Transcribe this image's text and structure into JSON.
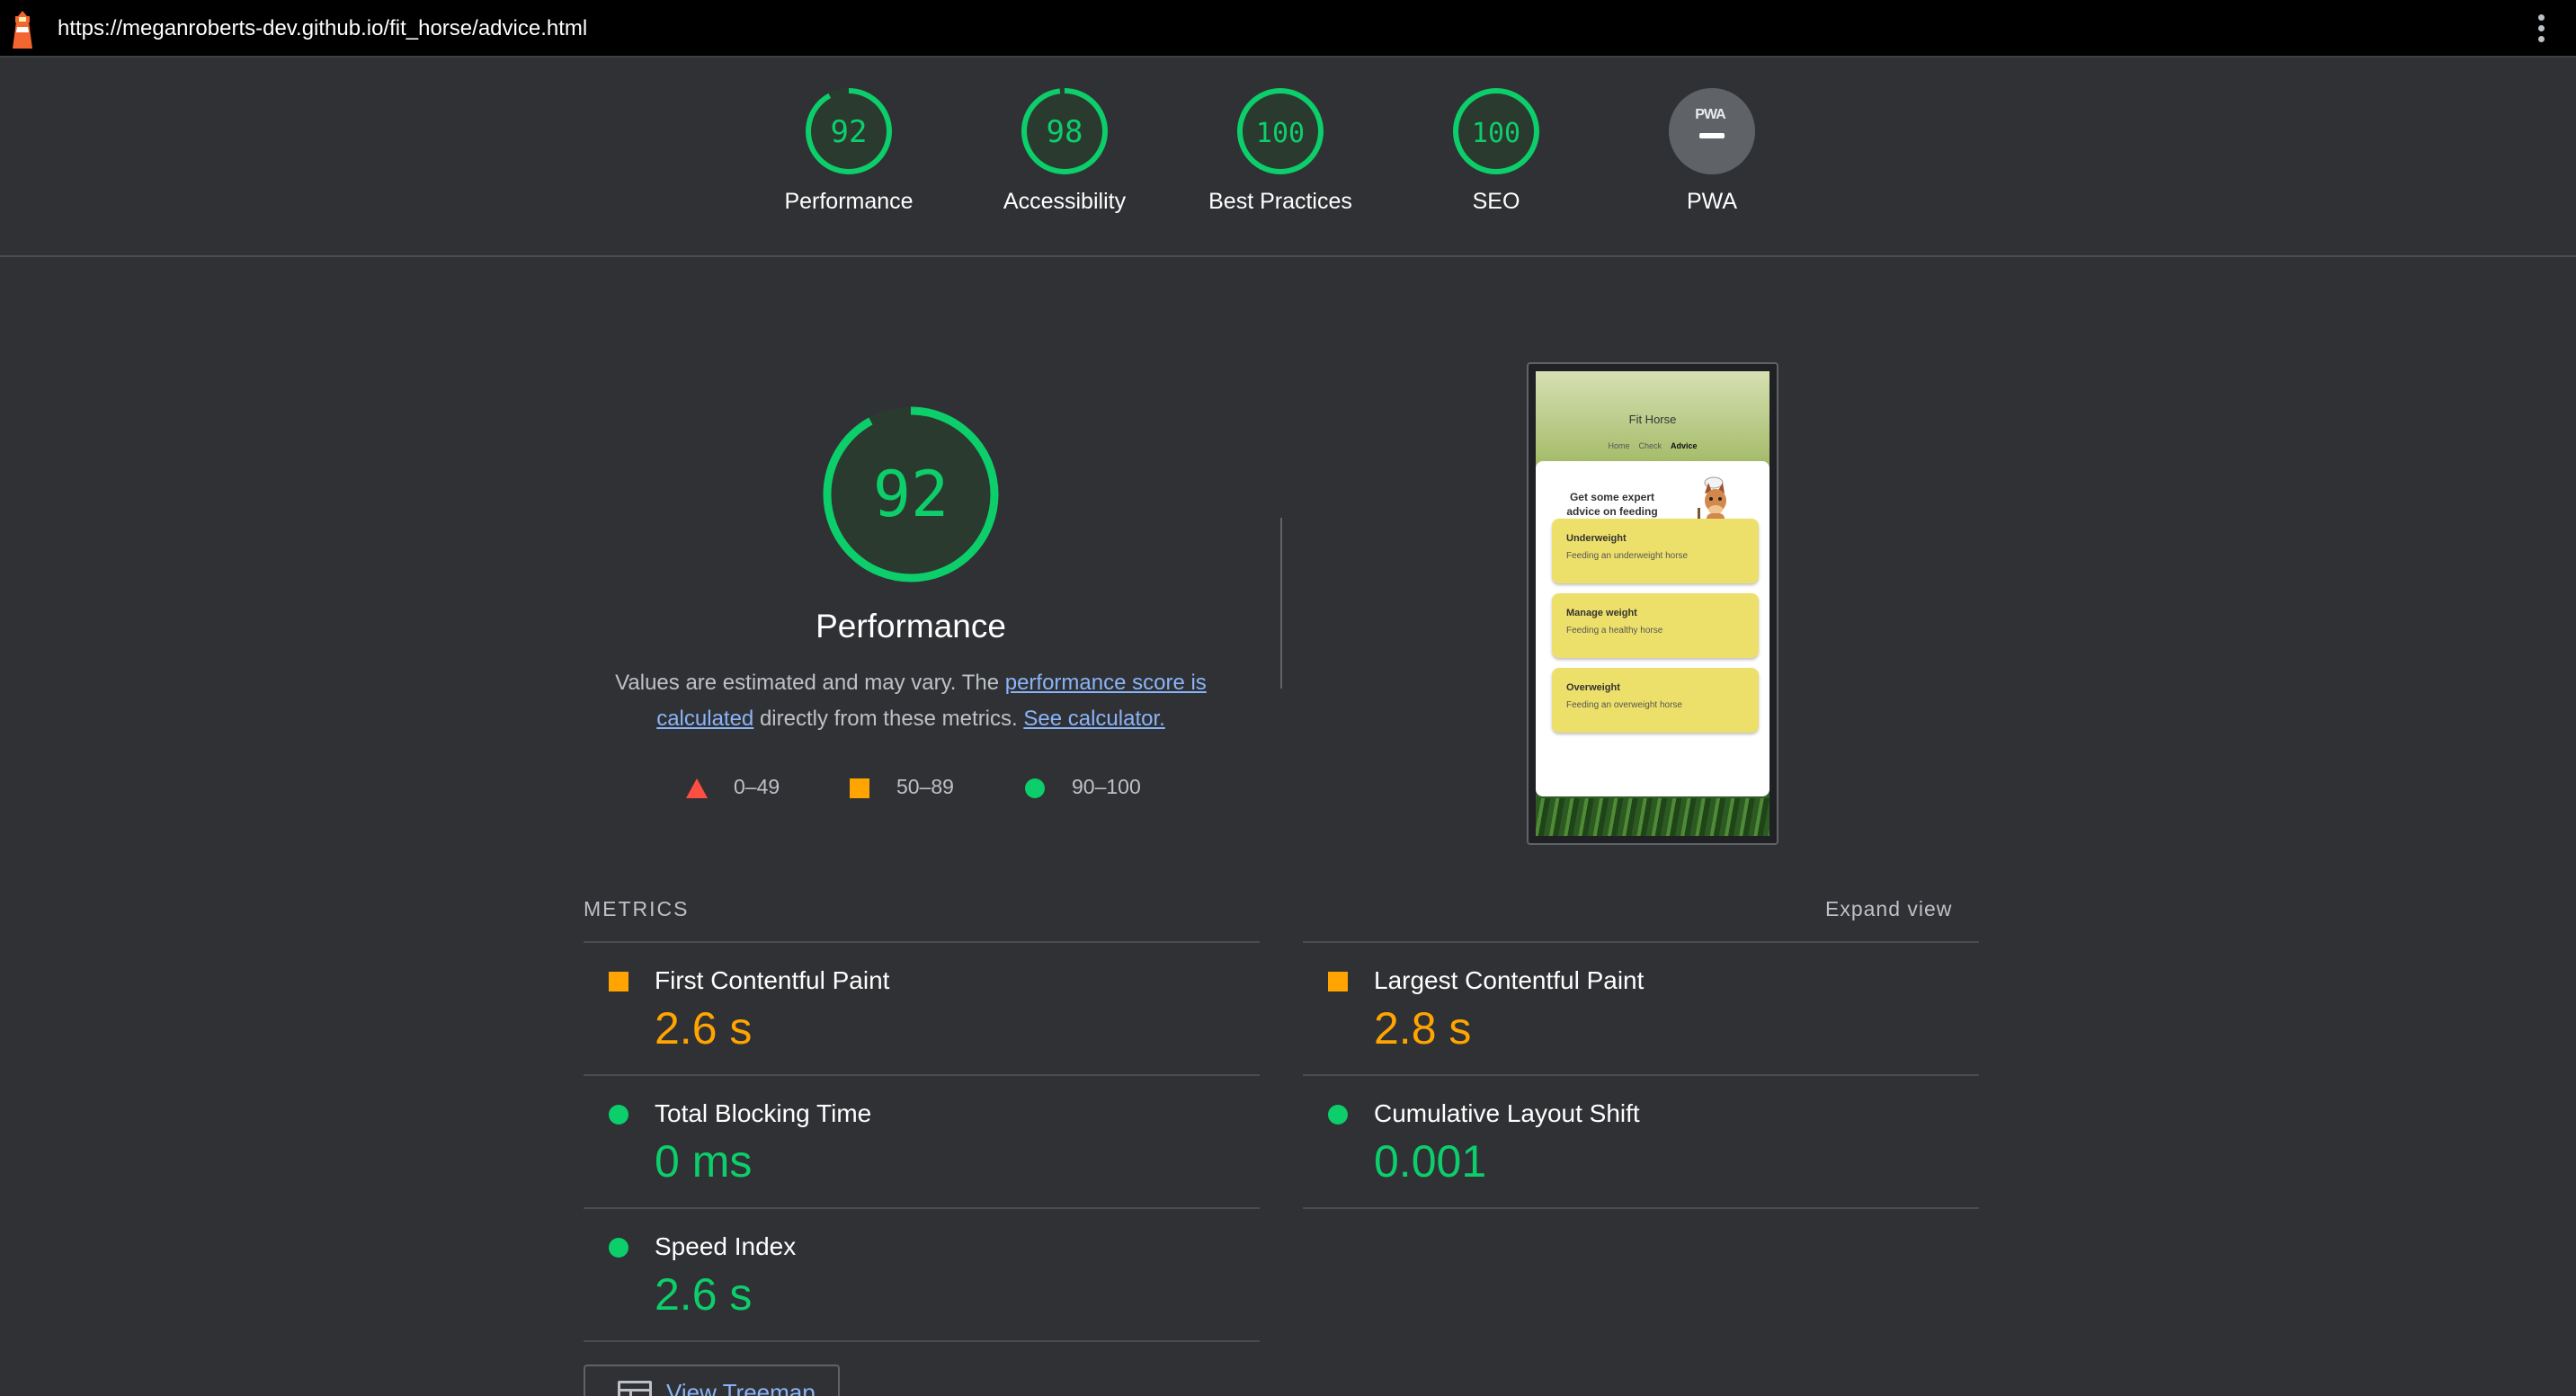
{
  "topbar": {
    "url": "https://meganroberts-dev.github.io/fit_horse/advice.html",
    "logo_icon": "lighthouse-icon",
    "menu_icon": "kebab-menu-icon"
  },
  "categories": [
    {
      "label": "Performance",
      "score": "92",
      "value": 92
    },
    {
      "label": "Accessibility",
      "score": "98",
      "value": 98
    },
    {
      "label": "Best Practices",
      "score": "100",
      "value": 100
    },
    {
      "label": "SEO",
      "score": "100",
      "value": 100
    },
    {
      "label": "PWA",
      "badge": "PWA"
    }
  ],
  "performance": {
    "score": "92",
    "value": 92,
    "title": "Performance",
    "desc_prefix": "Values are estimated and may vary. The ",
    "link_score": "performance score is calculated",
    "desc_mid": " directly from these metrics. ",
    "link_calc": "See calculator.",
    "legend": [
      {
        "shape": "triangle",
        "range": "0–49",
        "color": "#ff4e42"
      },
      {
        "shape": "square",
        "range": "50–89",
        "color": "#ffa400"
      },
      {
        "shape": "circle",
        "range": "90–100",
        "color": "#0cce6b"
      }
    ]
  },
  "thumbnail": {
    "site_title": "Fit Horse",
    "nav": [
      "Home",
      "Check",
      "Advice"
    ],
    "heading": "Get some expert advice on feeding your horse.",
    "options": [
      {
        "title": "Underweight",
        "subtitle": "Feeding an underweight horse"
      },
      {
        "title": "Manage weight",
        "subtitle": "Feeding a healthy horse"
      },
      {
        "title": "Overweight",
        "subtitle": "Feeding an overweight horse"
      }
    ]
  },
  "metrics": {
    "header": "METRICS",
    "expand": "Expand view",
    "items": [
      {
        "label": "First Contentful Paint",
        "value": "2.6 s",
        "status": "average"
      },
      {
        "label": "Largest Contentful Paint",
        "value": "2.8 s",
        "status": "average"
      },
      {
        "label": "Total Blocking Time",
        "value": "0 ms",
        "status": "pass"
      },
      {
        "label": "Cumulative Layout Shift",
        "value": "0.001",
        "status": "pass"
      },
      {
        "label": "Speed Index",
        "value": "2.6 s",
        "status": "pass"
      }
    ],
    "treemap_button": "View Treemap"
  },
  "colors": {
    "pass": "#0cce6b",
    "average": "#ffa400",
    "fail": "#ff4e42",
    "link": "#8ab4f8"
  }
}
